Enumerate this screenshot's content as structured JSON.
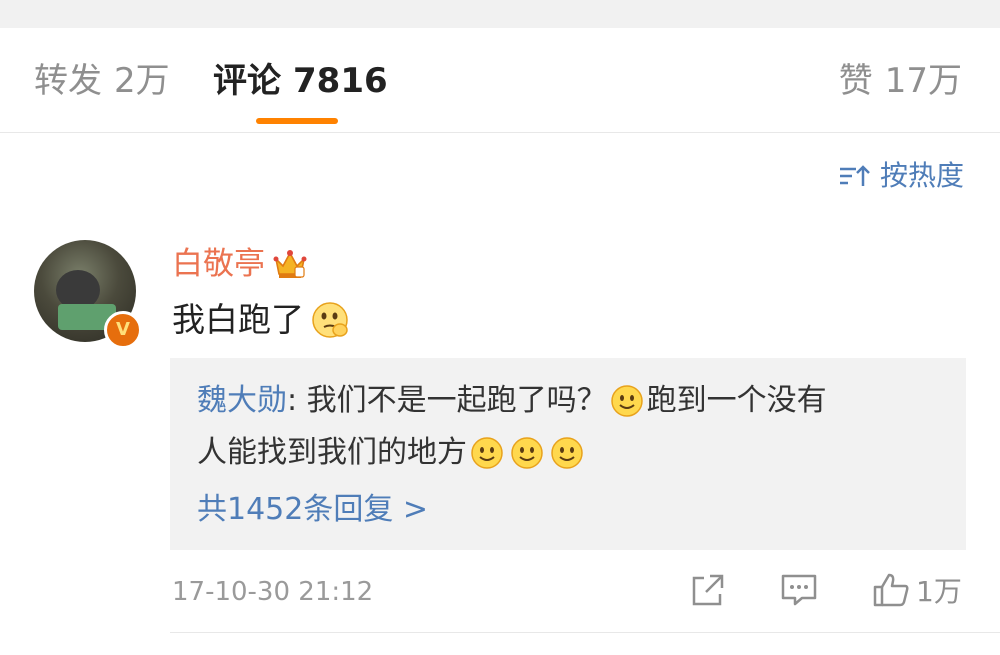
{
  "tabs": {
    "repost": {
      "label": "转发",
      "count": "2万"
    },
    "comments": {
      "label": "评论",
      "count": "7816"
    },
    "likes": {
      "label": "赞",
      "count": "17万"
    }
  },
  "sort": {
    "label": "按热度",
    "icon": "sort-icon"
  },
  "comment": {
    "username": "白敬亭",
    "text": "我白跑了",
    "timestamp": "17-10-30 21:12",
    "like_count": "1万",
    "badge": "V"
  },
  "reply": {
    "author": "魏大勋",
    "line1": ": 我们不是一起跑了吗？",
    "line1_after": "跑到一个没有",
    "line2": "人能找到我们的地方",
    "count_label": "共1452条回复 >"
  },
  "colors": {
    "accent": "#ff8200",
    "link": "#4f7db8",
    "username": "#eb7350"
  }
}
